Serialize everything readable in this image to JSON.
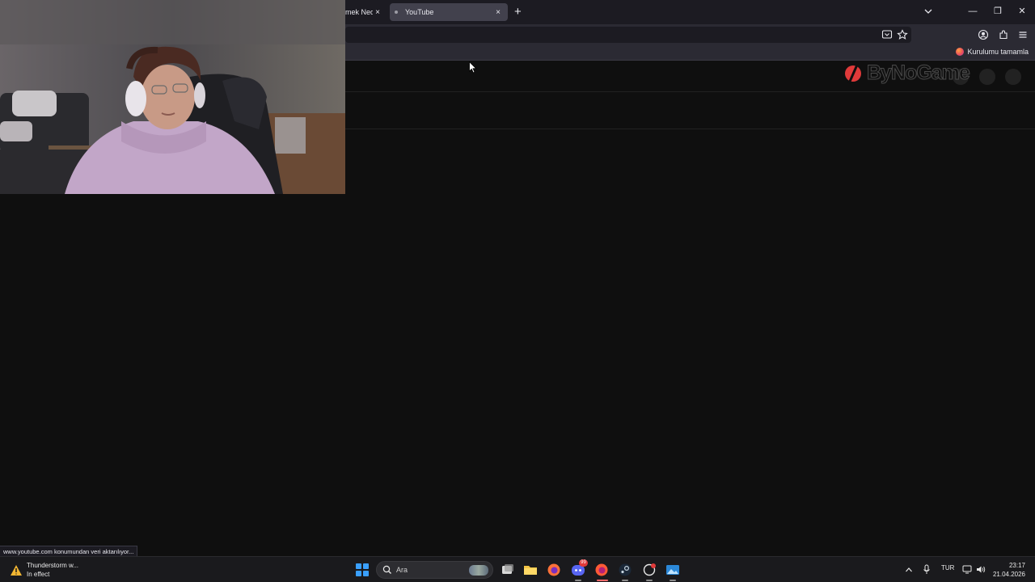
{
  "browser": {
    "tabs": [
      {
        "title": "mek Nede",
        "active": false
      },
      {
        "title": "YouTube",
        "active": true
      }
    ],
    "tab_close_glyph": "×",
    "new_tab_glyph": "+",
    "window_controls": {
      "minimize": "—",
      "restore": "❐",
      "close": "✕"
    },
    "setup_prompt": "Kurulumu tamamla"
  },
  "page": {
    "watermark": "ByNoGame"
  },
  "status_url": "www.youtube.com konumundan veri aktarılıyor...",
  "taskbar": {
    "weather_title": "Thunderstorm w...",
    "weather_subtitle": "In effect",
    "search_placeholder": "Ara",
    "discord_badge": "99",
    "language": "TUR",
    "time": "23:17",
    "date": "21.04.2026"
  },
  "colors": {
    "page_bg": "#0f0f0f",
    "tabbar_bg": "#1c1b22",
    "toolbar_bg": "#2b2a33",
    "active_tab_bg": "#42414d",
    "taskbar_bg": "#1a1a1d",
    "accent_blue": "#3aa0ff",
    "watermark_red": "#e03a3a"
  }
}
